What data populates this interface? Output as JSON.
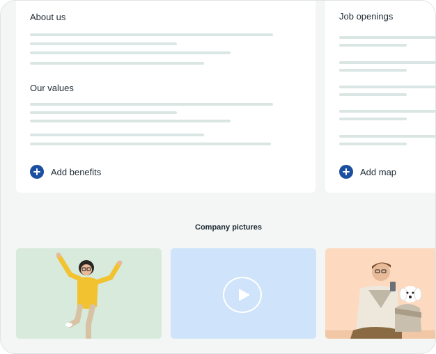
{
  "left_card": {
    "about_title": "About us",
    "values_title": "Our values",
    "add_benefits_label": "Add benefits"
  },
  "right_card": {
    "jobs_title": "Job openings",
    "add_map_label": "Add map"
  },
  "gallery": {
    "title": "Company pictures"
  },
  "colors": {
    "accent": "#1c4fa0",
    "placeholder_line": "#d9e6e4",
    "tile_green": "#d7eadb",
    "tile_blue": "#cfe4fa",
    "tile_peach": "#fcd9bf"
  }
}
